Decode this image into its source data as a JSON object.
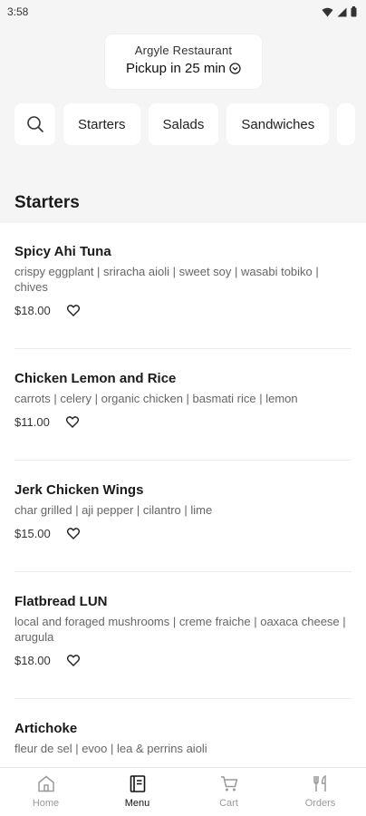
{
  "status": {
    "time": "3:58"
  },
  "header": {
    "restaurant": "Argyle Restaurant",
    "pickup": "Pickup in 25 min"
  },
  "categories": [
    "Starters",
    "Salads",
    "Sandwiches"
  ],
  "section": {
    "title": "Starters"
  },
  "items": [
    {
      "name": "Spicy Ahi Tuna",
      "desc": "crispy eggplant | sriracha aioli | sweet soy | wasabi tobiko | chives",
      "price": "$18.00"
    },
    {
      "name": "Chicken Lemon and Rice",
      "desc": "carrots | celery | organic chicken | basmati rice | lemon",
      "price": "$11.00"
    },
    {
      "name": "Jerk Chicken Wings",
      "desc": "char grilled | aji pepper | cilantro | lime",
      "price": "$15.00"
    },
    {
      "name": "Flatbread LUN",
      "desc": "local and foraged mushrooms | creme fraiche | oaxaca cheese | arugula",
      "price": "$18.00"
    },
    {
      "name": "Artichoke",
      "desc": "fleur de sel | evoo | lea & perrins aioli",
      "price": ""
    }
  ],
  "nav": [
    {
      "label": "Home",
      "icon": "home-icon",
      "active": false
    },
    {
      "label": "Menu",
      "icon": "menu-book-icon",
      "active": true
    },
    {
      "label": "Cart",
      "icon": "cart-icon",
      "active": false
    },
    {
      "label": "Orders",
      "icon": "utensils-icon",
      "active": false
    }
  ],
  "colors": {
    "background": "#f5f5f5",
    "card": "#ffffff",
    "text": "#1b1b1b",
    "muted": "#666666",
    "inactive": "#9a9a9a"
  }
}
